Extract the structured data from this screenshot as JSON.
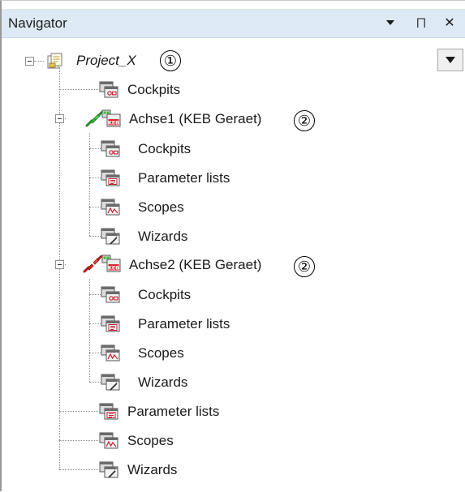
{
  "navigator": {
    "title": "Navigator",
    "pin_glyph": "⨅",
    "close_glyph": "✕",
    "menu_glyph": "▼",
    "project": {
      "label": "Project_X",
      "callout": "①"
    },
    "items": {
      "cockpits": "Cockpits",
      "parameter_lists": "Parameter lists",
      "scopes": "Scopes",
      "wizards": "Wizards"
    },
    "axis1": {
      "label": "Achse1 (KEB Geraet)",
      "callout": "②",
      "connection": "connected"
    },
    "axis2": {
      "label": "Achse2 (KEB Geraet)",
      "callout": "②",
      "connection": "disconnected"
    }
  },
  "colors": {
    "title_bg": "#ddeaf6",
    "connected": "#3cb53c",
    "disconnected": "#d62626",
    "keb_red": "#d4282c"
  }
}
